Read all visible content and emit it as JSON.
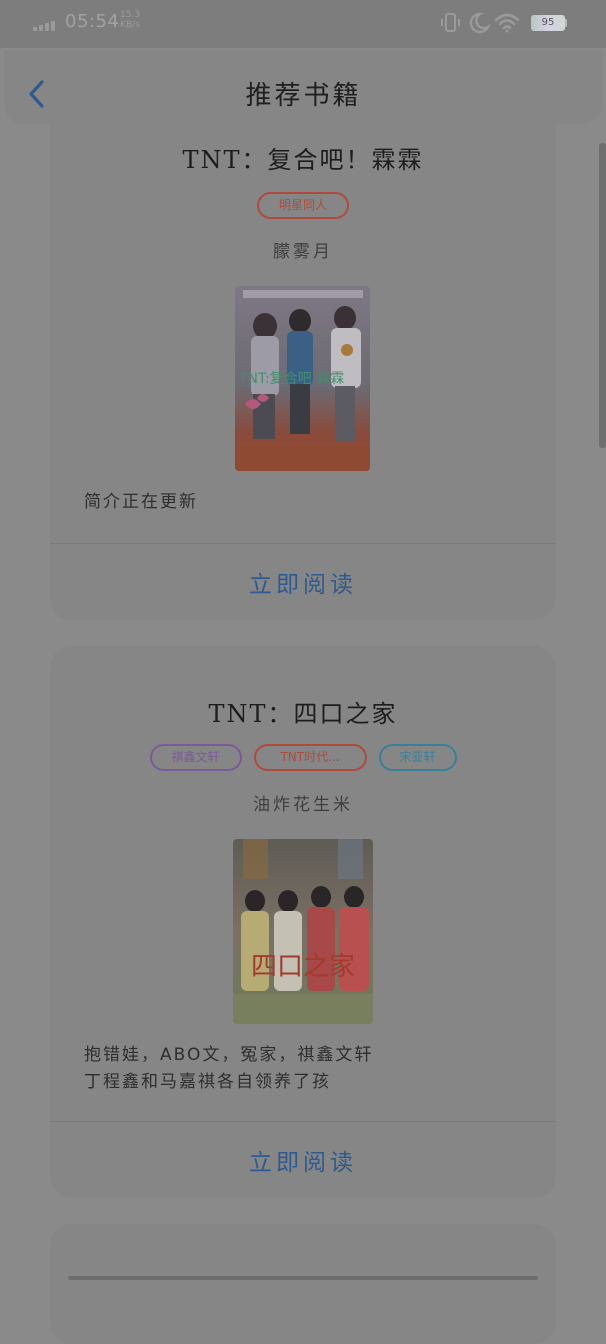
{
  "status_bar": {
    "time": "05:54",
    "net_speed_value": "15.3",
    "net_speed_unit": "KB/s",
    "battery": "95",
    "icons": [
      "signal-icon",
      "vibrate-icon",
      "moon-icon",
      "wifi-icon",
      "battery-icon"
    ]
  },
  "header": {
    "title": "推荐书籍",
    "back_icon": "chevron-left-icon"
  },
  "books": [
    {
      "title": "TNT：复合吧！霖霖",
      "tags": [
        {
          "label": "明星同人",
          "color": "#b04a3d"
        }
      ],
      "author": "朦雾月",
      "cover_caption": "TNT:复合吧 霖霖",
      "intro": "简介正在更新",
      "read_label": "立即阅读"
    },
    {
      "title": "TNT：四口之家",
      "tags": [
        {
          "label": "祺鑫文轩",
          "color": "#7a5a9a"
        },
        {
          "label": "TNT时代...",
          "color": "#b04a3d"
        },
        {
          "label": "宋亚轩",
          "color": "#3a7f9a"
        }
      ],
      "author": "油炸花生米",
      "cover_caption": "四口之家",
      "intro": "抱错娃，ABO文，冤家，祺鑫文轩\n丁程鑫和马嘉祺各自领养了孩",
      "read_label": "立即阅读"
    }
  ],
  "colors": {
    "accent": "#2f5a8f",
    "overlay_bg": "#8a8a8a"
  }
}
